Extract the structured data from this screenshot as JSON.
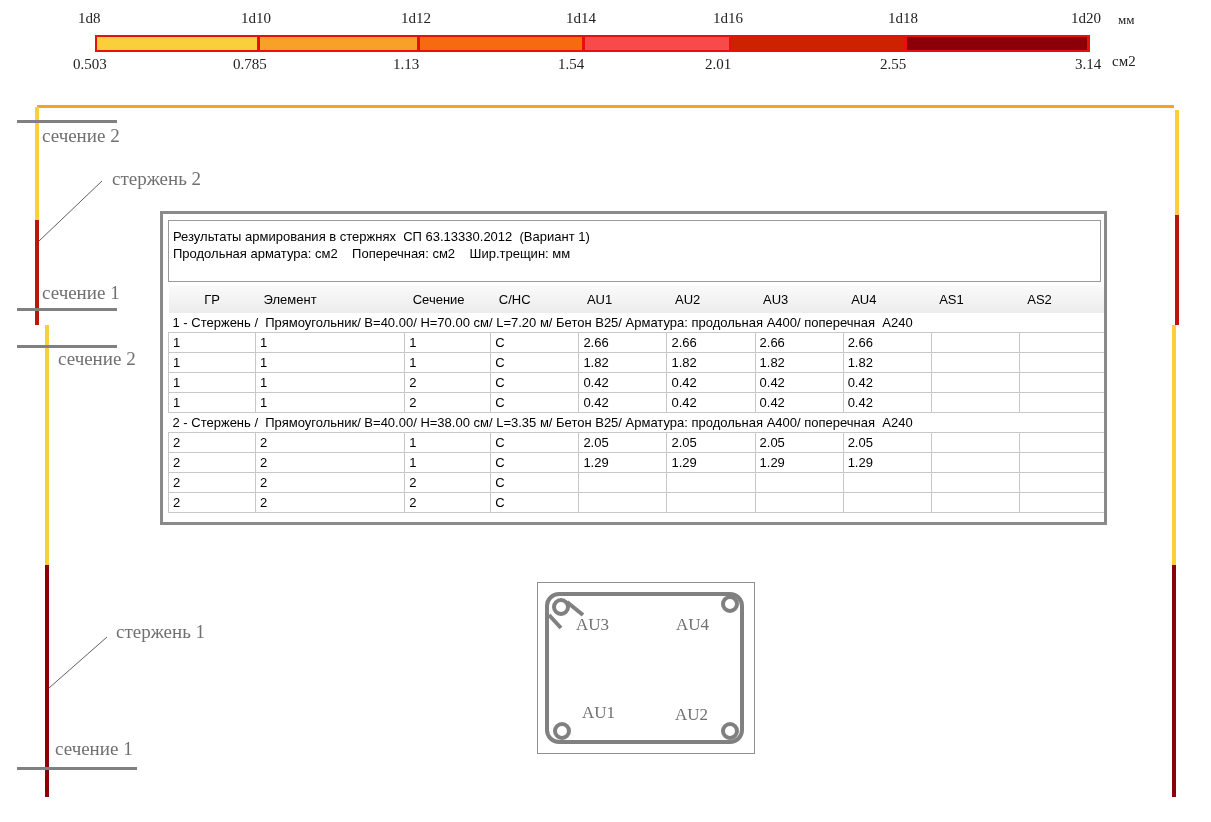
{
  "legend": {
    "diameters": [
      "1d8",
      "1d10",
      "1d12",
      "1d14",
      "1d16",
      "1d18",
      "1d20"
    ],
    "diameter_unit": "мм",
    "areas": [
      "0.503",
      "0.785",
      "1.13",
      "1.54",
      "2.01",
      "2.55",
      "3.14"
    ],
    "area_unit": "см2",
    "segments": [
      {
        "color": "#f9d03c"
      },
      {
        "color": "#f7a128"
      },
      {
        "color": "#f86a10"
      },
      {
        "color": "#f84a4a"
      },
      {
        "color": "#cc2200"
      },
      {
        "color": "#8b0008"
      }
    ]
  },
  "frame": {
    "rods": [
      {
        "segments": [
          {
            "color": "#f7a128"
          }
        ]
      },
      {
        "segments": [
          {
            "color": "#f9d03c"
          },
          {
            "color": "#b8180c"
          }
        ]
      },
      {
        "segments": [
          {
            "color": "#f9d03c"
          },
          {
            "color": "#8b0008"
          }
        ]
      },
      {
        "segments": [
          {
            "color": "#f9d03c"
          },
          {
            "color": "#b8180c"
          }
        ]
      },
      {
        "segments": [
          {
            "color": "#f9d03c"
          },
          {
            "color": "#8b0008"
          }
        ]
      }
    ],
    "section_labels": [
      "сечение 2",
      "сечение 1",
      "сечение 2",
      "сечение 1"
    ],
    "rod_labels": [
      "стержень 2",
      "стержень 1"
    ]
  },
  "results": {
    "title": "Результаты армирования в стержнях  СП 63.13330.2012  (Вариант 1)",
    "units": "Продольная арматура: см2    Поперечная: см2    Шир.трещин: мм",
    "columns": [
      "ГР",
      "Элемент",
      "Сечение",
      "С/НС",
      "AU1",
      "AU2",
      "AU3",
      "AU4",
      "AS1",
      "AS2"
    ],
    "groups": [
      {
        "title": "1 - Стержень /  Прямоугольник/ B=40.00/ H=70.00 см/ L=7.20 м/ Бетон B25/ Арматура: продольная А400/ поперечная  А240",
        "rows": [
          [
            "1",
            "1",
            "1",
            "С",
            "2.66",
            "2.66",
            "2.66",
            "2.66"
          ],
          [
            "1",
            "1",
            "1",
            "С",
            "1.82",
            "1.82",
            "1.82",
            "1.82"
          ],
          [
            "1",
            "1",
            "2",
            "С",
            "0.42",
            "0.42",
            "0.42",
            "0.42"
          ],
          [
            "1",
            "1",
            "2",
            "С",
            "0.42",
            "0.42",
            "0.42",
            "0.42"
          ]
        ]
      },
      {
        "title": "2 - Стержень /  Прямоугольник/ B=40.00/ H=38.00 см/ L=3.35 м/ Бетон B25/ Арматура: продольная А400/ поперечная  А240",
        "rows": [
          [
            "2",
            "2",
            "1",
            "С",
            "2.05",
            "2.05",
            "2.05",
            "2.05"
          ],
          [
            "2",
            "2",
            "1",
            "С",
            "1.29",
            "1.29",
            "1.29",
            "1.29"
          ],
          [
            "2",
            "2",
            "2",
            "С"
          ],
          [
            "2",
            "2",
            "2",
            "С"
          ]
        ]
      }
    ]
  },
  "cross_section": {
    "labels": [
      "AU3",
      "AU4",
      "AU1",
      "AU2"
    ]
  }
}
